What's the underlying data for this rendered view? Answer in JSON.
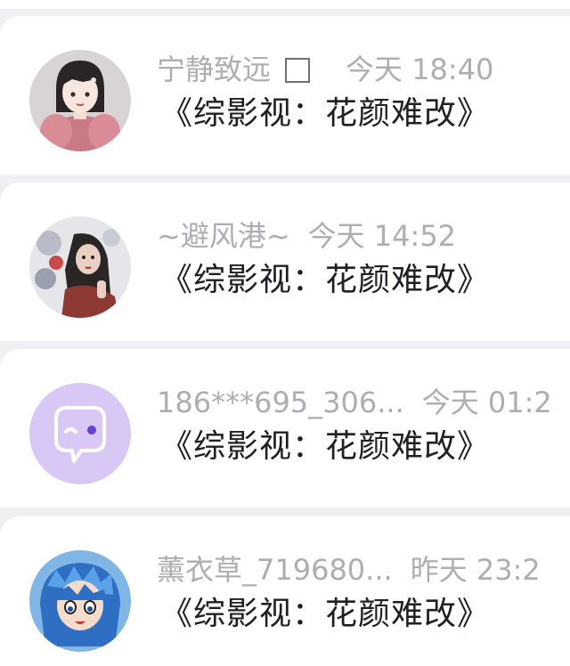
{
  "comments": [
    {
      "name": "宁静致远",
      "time": "今天 18:40",
      "message": "《综影视：花颜难改》",
      "has_checkbox": true,
      "avatar_icon": "anime-girl-avatar"
    },
    {
      "name": "~避风港~",
      "time": "今天 14:52",
      "message": "《综影视：花颜难改》",
      "has_checkbox": false,
      "avatar_icon": "photo-woman-avatar"
    },
    {
      "name": "186***695_306...",
      "time": "今天 01:2",
      "message": "《综影视：花颜难改》",
      "has_checkbox": false,
      "avatar_icon": "default-chat-bubble-avatar"
    },
    {
      "name": "薰衣草_719680...",
      "time": "昨天 23:2",
      "message": "《综影视：花颜难改》",
      "has_checkbox": false,
      "avatar_icon": "anime-blue-hair-avatar"
    }
  ],
  "colors": {
    "meta_text": "#adadb3",
    "message_text": "#202024",
    "default_avatar_bg": "#d9c8f5"
  }
}
